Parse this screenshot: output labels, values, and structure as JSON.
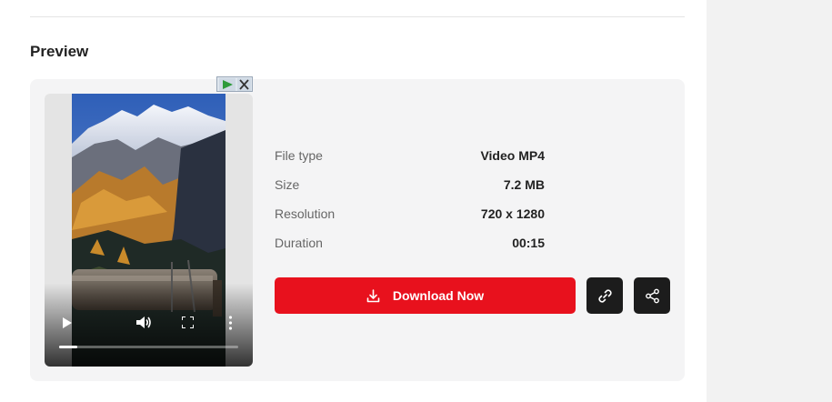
{
  "section": {
    "title": "Preview"
  },
  "details": [
    {
      "label": "File type",
      "value": "Video MP4"
    },
    {
      "label": "Size",
      "value": "7.2 MB"
    },
    {
      "label": "Resolution",
      "value": "720 x 1280"
    },
    {
      "label": "Duration",
      "value": "00:15"
    }
  ],
  "actions": {
    "download_label": "Download Now",
    "copy_link_icon": "link-icon",
    "share_icon": "share-icon"
  },
  "player": {
    "progress_fraction": 0.1,
    "icons": [
      "play-icon",
      "volume-icon",
      "fullscreen-icon",
      "more-options-icon"
    ]
  },
  "colors": {
    "accent": "#e8111d",
    "dark_button": "#1c1c1c",
    "panel": "#f4f4f5"
  }
}
